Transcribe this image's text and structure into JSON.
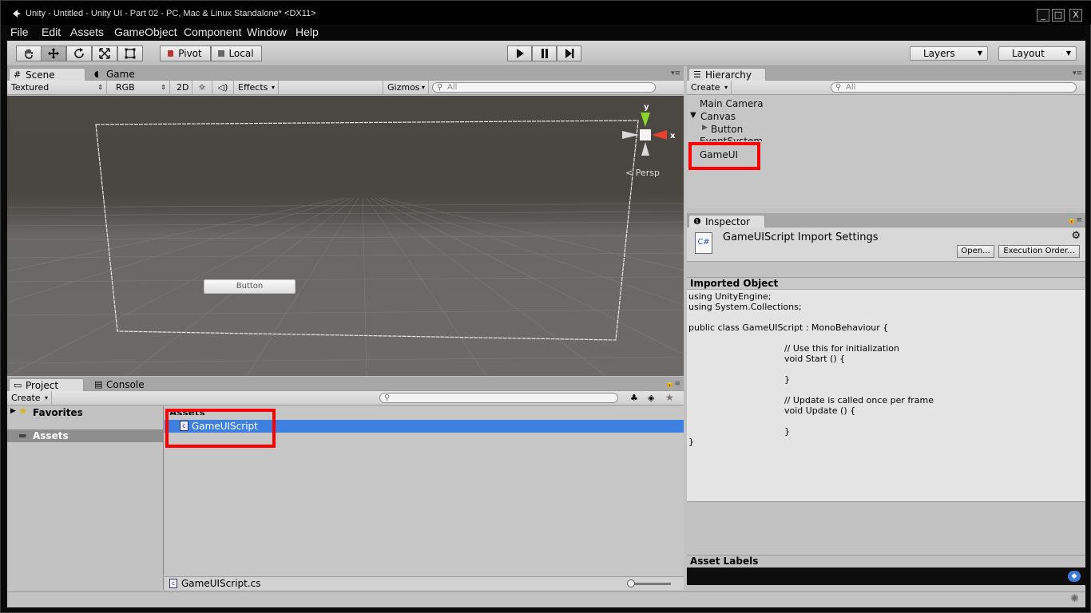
{
  "window": {
    "title": "Unity - Untitled - Unity UI - Part 02 - PC, Mac & Linux Standalone* <DX11>",
    "buttons": [
      "_",
      "□",
      "X"
    ]
  },
  "menu": [
    "File",
    "Edit",
    "Assets",
    "GameObject",
    "Component",
    "Window",
    "Help"
  ],
  "toolbar": {
    "tools": [
      "hand-icon",
      "move-icon",
      "rotate-icon",
      "scale-icon",
      "rect-icon"
    ],
    "pivot_label": "Pivot",
    "local_label": "Local",
    "layers_label": "Layers",
    "layout_label": "Layout"
  },
  "scene": {
    "tabs": [
      "Scene",
      "Game"
    ],
    "shading_mode": "Textured",
    "color_mode": "RGB",
    "mode_2d": "2D",
    "effects_label": "Effects",
    "gizmos_label": "Gizmos",
    "search_placeholder": "All",
    "button_text": "Button",
    "persp_label": "Persp",
    "axis_x": "x",
    "axis_y": "y"
  },
  "hierarchy": {
    "tab": "Hierarchy",
    "create_label": "Create",
    "search_placeholder": "All",
    "items": [
      "Main Camera",
      "Canvas",
      "Button",
      "EventSystem",
      "GameUI"
    ]
  },
  "inspector": {
    "tab": "Inspector",
    "title": "GameUIScript Import Settings",
    "open_label": "Open...",
    "exec_order_label": "Execution Order...",
    "section_title": "Imported Object",
    "code": [
      "using UnityEngine;",
      "using System.Collections;",
      "",
      "public class GameUIScript : MonoBehaviour {",
      "",
      "\t\t// Use this for initialization",
      "\t\tvoid Start () {",
      "",
      "\t\t}",
      "",
      "\t\t// Update is called once per frame",
      "\t\tvoid Update () {",
      "",
      "\t\t}",
      "}"
    ],
    "asset_labels": "Asset Labels"
  },
  "project": {
    "tabs": [
      "Project",
      "Console"
    ],
    "create_label": "Create",
    "favorites_label": "Favorites",
    "assets_label": "Assets",
    "assets_header": "Assets",
    "selected_item": "GameUIScript",
    "footer_file": "GameUIScript.cs"
  },
  "colors": {
    "highlight_red": "#ff0000",
    "selection_blue": "#3d80df"
  }
}
